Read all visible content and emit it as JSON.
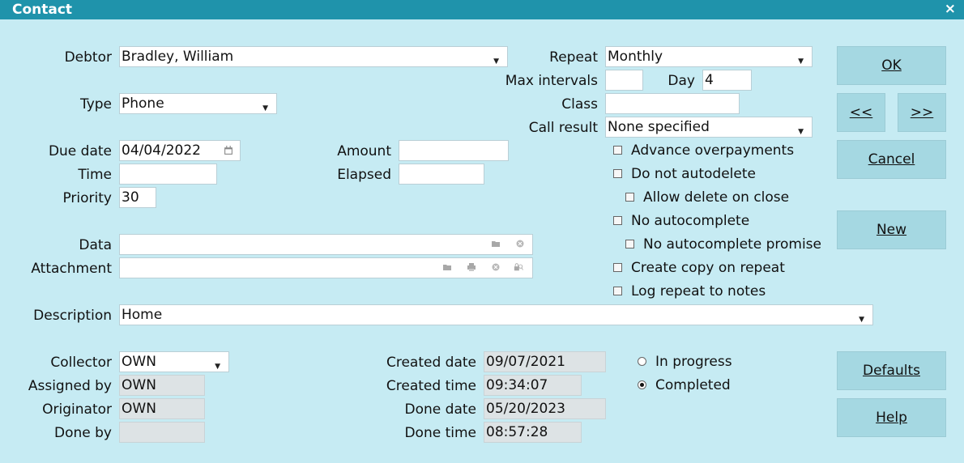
{
  "window": {
    "title": "Contact",
    "close_glyph": "×"
  },
  "labels": {
    "debtor": "Debtor",
    "type": "Type",
    "due_date": "Due date",
    "time": "Time",
    "priority": "Priority",
    "data": "Data",
    "attachment": "Attachment",
    "description": "Description",
    "amount": "Amount",
    "elapsed": "Elapsed",
    "repeat": "Repeat",
    "max_intervals": "Max intervals",
    "day": "Day",
    "class": "Class",
    "call_result": "Call result",
    "collector": "Collector",
    "assigned_by": "Assigned by",
    "originator": "Originator",
    "done_by": "Done by",
    "created_date": "Created date",
    "created_time": "Created time",
    "done_date": "Done date",
    "done_time": "Done time"
  },
  "values": {
    "debtor": "Bradley, William",
    "type": "Phone",
    "due_date": "04/04/2022",
    "time": "",
    "priority": "30",
    "data": "",
    "attachment": "",
    "description": "Home",
    "amount": "",
    "elapsed": "",
    "repeat": "Monthly",
    "max_intervals": "",
    "day": "4",
    "class": "",
    "call_result": "None specified",
    "collector": "OWN",
    "assigned_by": "OWN",
    "originator": "OWN",
    "done_by": "",
    "created_date": "09/07/2021",
    "created_time": "09:34:07",
    "done_date": "05/20/2023",
    "done_time": "08:57:28"
  },
  "checkboxes": [
    {
      "label": "Advance overpayments",
      "checked": false
    },
    {
      "label": "Do not autodelete",
      "checked": false
    },
    {
      "label": "Allow delete on close",
      "checked": false
    },
    {
      "label": "No autocomplete",
      "checked": false
    },
    {
      "label": "No autocomplete promise",
      "checked": false
    },
    {
      "label": "Create copy on repeat",
      "checked": false
    },
    {
      "label": "Log repeat to notes",
      "checked": false
    }
  ],
  "status": [
    {
      "label": "In progress",
      "selected": false
    },
    {
      "label": "Completed",
      "selected": true
    }
  ],
  "buttons": {
    "ok": "OK",
    "prev": "<<",
    "next": ">>",
    "cancel": "Cancel",
    "new": "New",
    "defaults": "Defaults",
    "help": "Help"
  },
  "icons": {
    "dropdown": "▼",
    "calendar": "calendar-icon",
    "folder": "folder-icon",
    "clear": "clear-icon",
    "print": "print-icon",
    "lock": "lock-icon"
  }
}
